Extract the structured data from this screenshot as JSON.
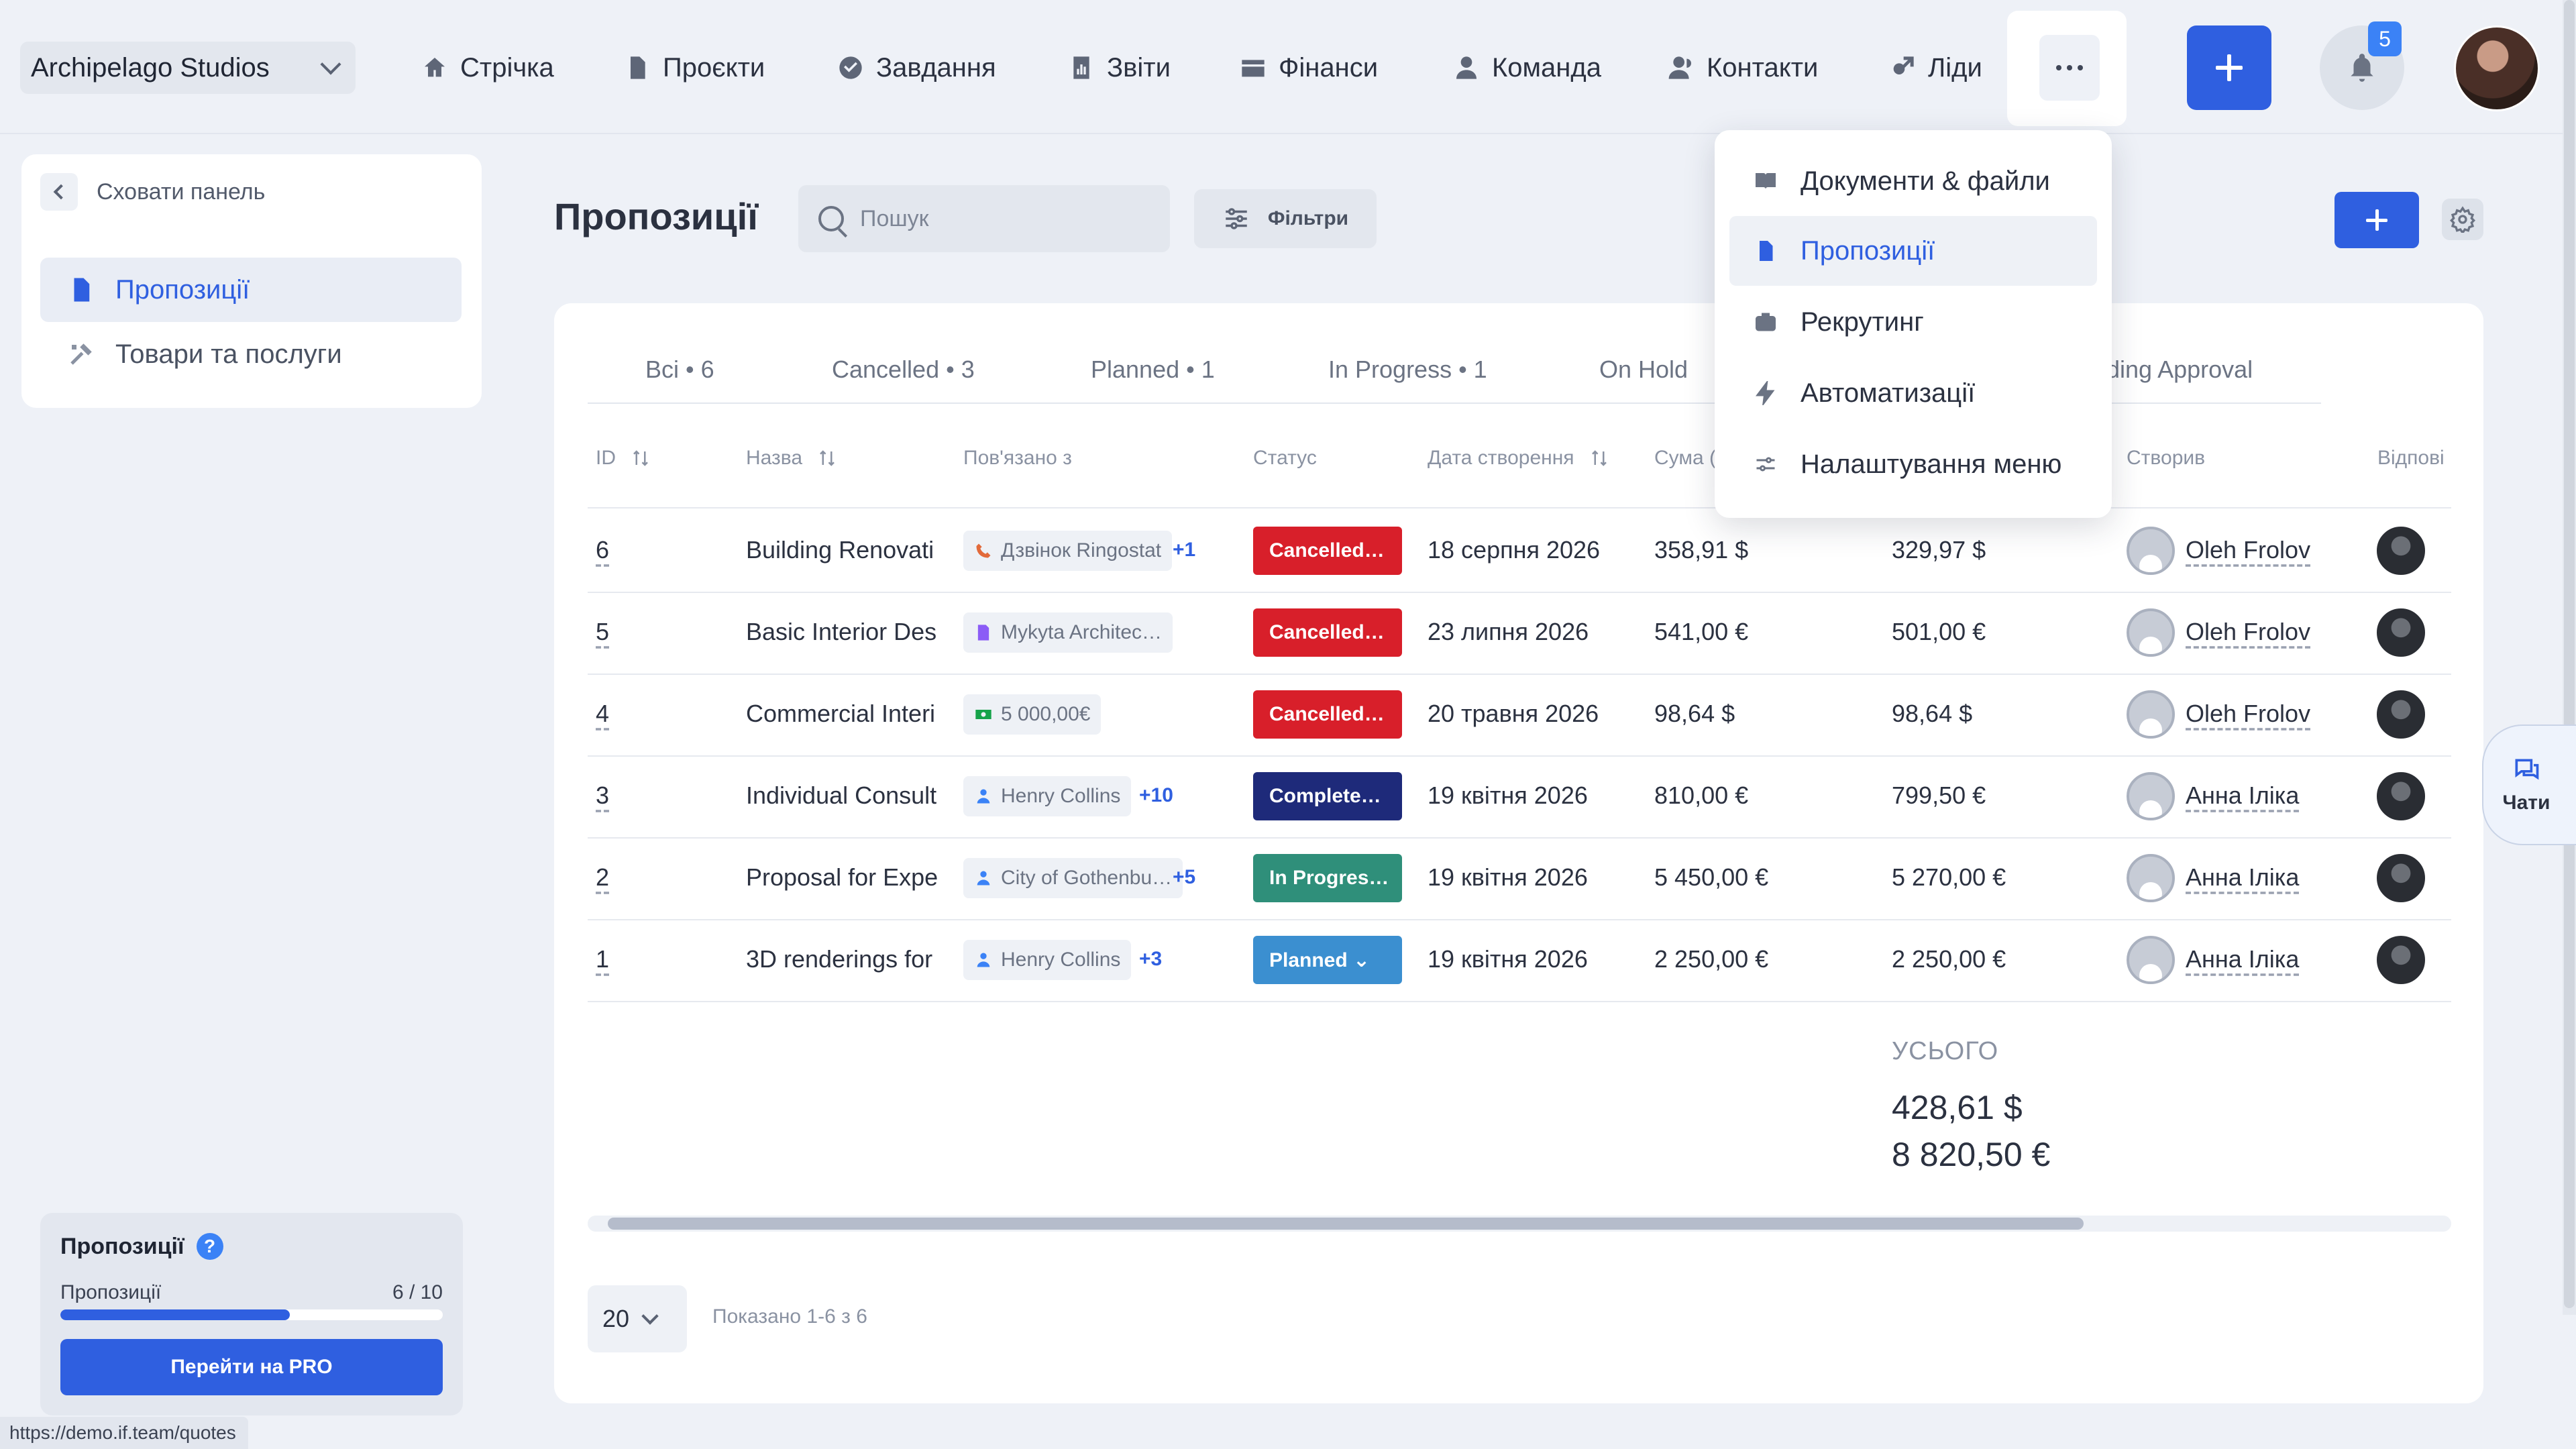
{
  "workspace": {
    "name": "Archipelago Studios"
  },
  "nav": [
    {
      "label": "Стрічка",
      "icon": "home-icon"
    },
    {
      "label": "Проєкти",
      "icon": "document-icon"
    },
    {
      "label": "Завдання",
      "icon": "check-circle-icon"
    },
    {
      "label": "Звіти",
      "icon": "chart-icon"
    },
    {
      "label": "Фінанси",
      "icon": "wallet-icon"
    },
    {
      "label": "Команда",
      "icon": "user-icon"
    },
    {
      "label": "Контакти",
      "icon": "contacts-icon"
    },
    {
      "label": "Ліди",
      "icon": "leads-icon"
    }
  ],
  "notifications": {
    "count": "5"
  },
  "more_menu": [
    {
      "label": "Документи & файли",
      "icon": "book-icon"
    },
    {
      "label": "Пропозиції",
      "icon": "document-icon",
      "active": true
    },
    {
      "label": "Рекрутинг",
      "icon": "briefcase-icon"
    },
    {
      "label": "Автоматизації",
      "icon": "lightning-icon"
    },
    {
      "label": "Налаштування меню",
      "icon": "sliders-icon"
    }
  ],
  "sidebar": {
    "hide_label": "Сховати панель",
    "items": [
      {
        "label": "Пропозиції",
        "active": true
      },
      {
        "label": "Товари та послуги",
        "active": false
      }
    ],
    "plan": {
      "title": "Пропозиції",
      "help": "?",
      "label": "Пропозиції",
      "count": "6 / 10",
      "progress": 0.6,
      "cta": "Перейти на PRO"
    }
  },
  "status_url": "https://demo.if.team/quotes",
  "header": {
    "title": "Пропозиції",
    "search_placeholder": "Пошук",
    "filters_label": "Фільтри"
  },
  "tabs": [
    "Всі • 6",
    "Cancelled • 3",
    "Planned • 1",
    "In Progress • 1",
    "On Hold",
    "ding Approval"
  ],
  "columns": {
    "id": "ID",
    "name": "Назва",
    "related": "Пов'язано з",
    "status": "Статус",
    "created": "Дата створення",
    "sum": "Сума (",
    "creator": "Створив",
    "responsible": "Відпові"
  },
  "rows": [
    {
      "id": "6",
      "name": "Building Renovati",
      "related": "Дзвінок Ringostat",
      "related_icon": "call-icon",
      "related_color": "#e26a3a",
      "more": "+1",
      "status": "Cancelled…",
      "status_color": "#d81f2a",
      "date": "18 серпня 2026",
      "sum1": "358,91 $",
      "sum2": "329,97 $",
      "creator": "Oleh Frolov"
    },
    {
      "id": "5",
      "name": "Basic Interior Des",
      "related": "Mykyta Architec…",
      "related_icon": "project-icon",
      "related_color": "#8b5cf6",
      "more": "",
      "status": "Cancelled…",
      "status_color": "#d81f2a",
      "date": "23 липня 2026",
      "sum1": "541,00 €",
      "sum2": "501,00 €",
      "creator": "Oleh Frolov"
    },
    {
      "id": "4",
      "name": "Commercial Interi",
      "related": "5 000,00€",
      "related_icon": "money-icon",
      "related_color": "#16a34a",
      "more": "",
      "status": "Cancelled…",
      "status_color": "#d81f2a",
      "date": "20 травня 2026",
      "sum1": "98,64 $",
      "sum2": "98,64 $",
      "creator": "Oleh Frolov"
    },
    {
      "id": "3",
      "name": "Individual Consult",
      "related": "Henry Collins",
      "related_icon": "contact-icon",
      "related_color": "#3b82f6",
      "more": "+10",
      "status": "Complete…",
      "status_color": "#1e2a7a",
      "date": "19 квітня 2026",
      "sum1": "810,00 €",
      "sum2": "799,50 €",
      "creator": "Анна Іліка"
    },
    {
      "id": "2",
      "name": "Proposal for Expe",
      "related": "City of Gothenbu…",
      "related_icon": "contact-icon",
      "related_color": "#3b82f6",
      "more": "+5",
      "status": "In Progres…",
      "status_color": "#2f8f7a",
      "date": "19 квітня 2026",
      "sum1": "5 450,00 €",
      "sum2": "5 270,00 €",
      "creator": "Анна Іліка"
    },
    {
      "id": "1",
      "name": "3D renderings for",
      "related": "Henry Collins",
      "related_icon": "contact-icon",
      "related_color": "#3b82f6",
      "more": "+3",
      "status": "Planned ⌄",
      "status_color": "#3b8fd0",
      "date": "19 квітня 2026",
      "sum1": "2 250,00 €",
      "sum2": "2 250,00 €",
      "creator": "Анна Іліка"
    }
  ],
  "totals": {
    "label": "УСЬОГО",
    "usd": "428,61 $",
    "eur": "8 820,50 €"
  },
  "pagination": {
    "page_size": "20",
    "shown": "Показано 1-6 з 6"
  },
  "chats": {
    "label": "Чати"
  }
}
